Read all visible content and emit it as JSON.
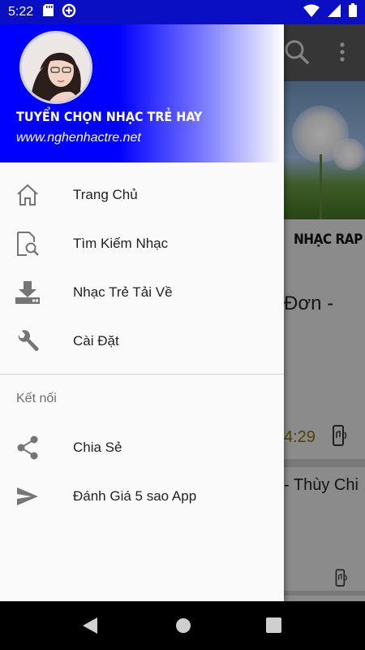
{
  "status_bar": {
    "time": "5:22",
    "icons": [
      "sd-card-icon",
      "data-saver-icon",
      "wifi-icon",
      "signal-icon",
      "battery-icon"
    ]
  },
  "drawer": {
    "header": {
      "title": "TUYỂN CHỌN NHẠC TRẺ HAY",
      "url": "www.nghenhactre.net",
      "avatar": "avatar-photo"
    },
    "main_items": [
      {
        "label": "Trang Chủ",
        "icon": "home-icon"
      },
      {
        "label": "Tìm Kiếm Nhạc",
        "icon": "search-file-icon"
      },
      {
        "label": "Nhạc Trẻ Tải Về",
        "icon": "download-icon"
      },
      {
        "label": "Cài Đặt",
        "icon": "wrench-icon"
      }
    ],
    "section_title": "Kết nối",
    "secondary_items": [
      {
        "label": "Chia Sẻ",
        "icon": "share-icon"
      },
      {
        "label": "Đánh Giá 5 sao App",
        "icon": "send-icon"
      }
    ]
  },
  "background": {
    "category_label": "NHẠC RAP",
    "item1_title_fragment": "Đơn -",
    "item1_duration": "4:29",
    "item2_title_fragment": "- Thùy Chi"
  },
  "nav_bar": {
    "buttons": [
      "back-button",
      "home-button",
      "recents-button"
    ]
  },
  "colors": {
    "header_blue": "#0000ff",
    "status_bar": "#0a0fc4",
    "drawer_bg": "#fafafa",
    "icon_gray": "#757575"
  }
}
